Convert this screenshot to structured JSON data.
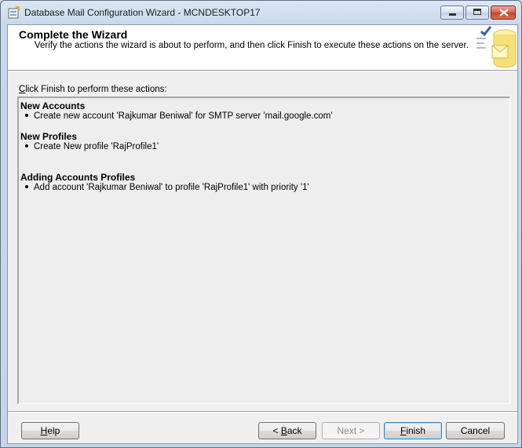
{
  "window": {
    "title": "Database Mail Configuration Wizard - MCNDESKTOP17"
  },
  "banner": {
    "title": "Complete the Wizard",
    "subtitle": "Verify the actions the wizard is about to perform, and then click Finish to execute these actions on the server."
  },
  "prompt": {
    "accel": "C",
    "rest": "lick Finish to perform these actions:"
  },
  "sections": [
    {
      "title": "New Accounts",
      "item": "Create new account 'Rajkumar Beniwal' for SMTP server 'mail.google.com'"
    },
    {
      "title": "New Profiles",
      "item": "Create New profile 'RajProfile1'"
    },
    {
      "title": "Adding Accounts Profiles",
      "item": "Add account 'Rajkumar Beniwal' to profile 'RajProfile1' with priority '1'"
    }
  ],
  "buttons": {
    "help": {
      "accel": "H",
      "rest": "elp"
    },
    "back": {
      "pre": "< ",
      "accel": "B",
      "rest": "ack"
    },
    "next": "Next >",
    "finish": {
      "accel": "F",
      "rest": "inish"
    },
    "cancel": "Cancel"
  },
  "colors": {
    "frame": "#c6d6e8",
    "close_button": "#c3422a",
    "default_button_border": "#3c7fb1"
  }
}
